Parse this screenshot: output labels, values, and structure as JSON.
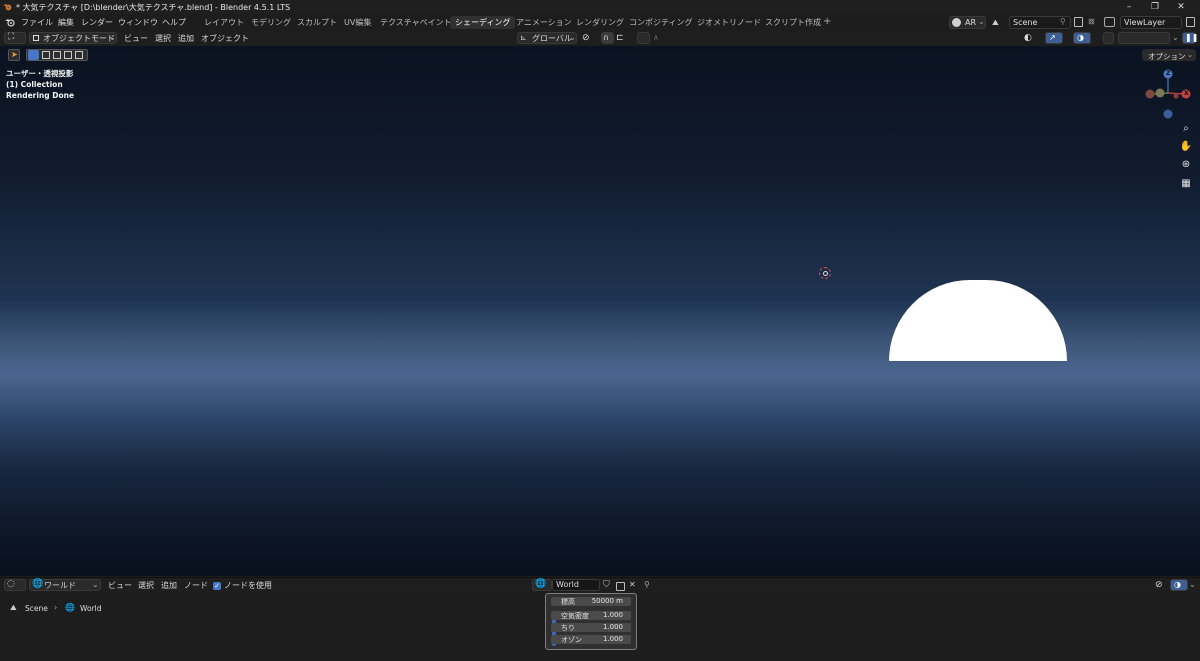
{
  "window": {
    "title": "* 大気テクスチャ [D:\\blender\\大気テクスチャ.blend] - Blender 4.5.1 LTS",
    "minimize": "–",
    "maximize": "❐",
    "close": "✕"
  },
  "menu": [
    "ファイル",
    "編集",
    "レンダー",
    "ウィンドウ",
    "ヘルプ"
  ],
  "workspaces": [
    {
      "label": "レイアウト",
      "active": false
    },
    {
      "label": "モデリング",
      "active": false
    },
    {
      "label": "スカルプト",
      "active": false
    },
    {
      "label": "UV編集",
      "active": false
    },
    {
      "label": "テクスチャペイント",
      "active": false
    },
    {
      "label": "シェーディング",
      "active": true
    },
    {
      "label": "アニメーション",
      "active": false
    },
    {
      "label": "レンダリング",
      "active": false
    },
    {
      "label": "コンポジティング",
      "active": false
    },
    {
      "label": "ジオメトリノード",
      "active": false
    },
    {
      "label": "スクリプト作成",
      "active": false
    }
  ],
  "add_workspace": "+",
  "top_right": {
    "ar": "AR",
    "scene": "Scene",
    "view_layer": "ViewLayer"
  },
  "viewport_header": {
    "mode": "オブジェクトモード",
    "menus": [
      "ビュー",
      "選択",
      "追加",
      "オブジェクト"
    ],
    "transform_orientation": "グローバル",
    "options": "オプション"
  },
  "viewport": {
    "overlay": [
      "ユーザー・透視投影",
      "(1) Collection",
      "Rendering Done"
    ],
    "gizmo": {
      "z": "Z",
      "x": "X"
    }
  },
  "node_editor": {
    "type": "ワールド",
    "menus": [
      "ビュー",
      "選択",
      "追加",
      "ノード"
    ],
    "use_nodes": "ノードを使用",
    "use_nodes_checked": true,
    "world_name": "World",
    "breadcrumb": [
      "Scene",
      "World"
    ]
  },
  "node_panel": {
    "altitude": {
      "label": "標高",
      "value": "50000 m"
    },
    "params": [
      {
        "label": "空気密度",
        "value": "1.000"
      },
      {
        "label": "ちり",
        "value": "1.000"
      },
      {
        "label": "オゾン",
        "value": "1.000"
      }
    ]
  },
  "colors": {
    "active_tab": "#303030",
    "accent_blue": "#4677c9",
    "gizmo_x": "#c6423f",
    "gizmo_y": "#6a9a3c",
    "gizmo_z": "#4a78c0",
    "sun": "#ffffff",
    "horizon": "#4a6690"
  }
}
